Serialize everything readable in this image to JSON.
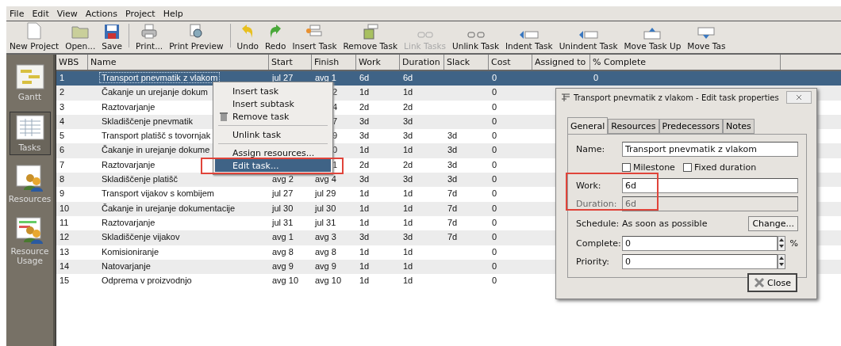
{
  "menu_bar": [
    "File",
    "Edit",
    "View",
    "Actions",
    "Project",
    "Help"
  ],
  "toolbar": [
    {
      "kind": "button",
      "label": "New Project",
      "disabled": false
    },
    {
      "kind": "button",
      "label": "Open...",
      "disabled": false
    },
    {
      "kind": "button",
      "label": "Save",
      "disabled": false
    },
    {
      "kind": "separator"
    },
    {
      "kind": "button",
      "label": "Print...",
      "disabled": false
    },
    {
      "kind": "button",
      "label": "Print Preview",
      "disabled": false
    },
    {
      "kind": "separator"
    },
    {
      "kind": "button",
      "label": "Undo",
      "disabled": false
    },
    {
      "kind": "button",
      "label": "Redo",
      "disabled": false
    },
    {
      "kind": "button",
      "label": "Insert Task",
      "disabled": false
    },
    {
      "kind": "button",
      "label": "Remove Task",
      "disabled": false
    },
    {
      "kind": "button",
      "label": "Link Tasks",
      "disabled": true
    },
    {
      "kind": "button",
      "label": "Unlink Task",
      "disabled": false
    },
    {
      "kind": "button",
      "label": "Indent Task",
      "disabled": false
    },
    {
      "kind": "button",
      "label": "Unindent Task",
      "disabled": false
    },
    {
      "kind": "button",
      "label": "Move Task Up",
      "disabled": false
    },
    {
      "kind": "button",
      "label": "Move Tas",
      "disabled": false
    }
  ],
  "sidebar": {
    "items": [
      {
        "label": "Gantt",
        "selected": false
      },
      {
        "label": "Tasks",
        "selected": true
      },
      {
        "label": "Resources",
        "selected": false
      },
      {
        "label": "Resource Usage",
        "selected": false
      }
    ]
  },
  "table": {
    "columns": [
      "WBS",
      "Name",
      "Start",
      "Finish",
      "Work",
      "Duration",
      "Slack",
      "Cost",
      "Assigned to",
      "% Complete"
    ],
    "rows": [
      {
        "selected": true,
        "cells": [
          "1",
          "Transport pnevmatik z vlakom",
          "jul 27",
          "avg 1",
          "6d",
          "6d",
          "",
          "0",
          "",
          "0"
        ]
      },
      {
        "selected": false,
        "cells": [
          "2",
          "Čakanje un urejanje dokum",
          "",
          "2",
          "1d",
          "1d",
          "",
          "0",
          "",
          ""
        ]
      },
      {
        "selected": false,
        "cells": [
          "3",
          "Raztovarjanje",
          "",
          "4",
          "2d",
          "2d",
          "",
          "0",
          "",
          ""
        ]
      },
      {
        "selected": false,
        "cells": [
          "4",
          "Skladiščenje pnevmatik",
          "",
          "7",
          "3d",
          "3d",
          "",
          "0",
          "",
          ""
        ]
      },
      {
        "selected": false,
        "cells": [
          "5",
          "Transport platišč s tovornjak",
          "",
          "9",
          "3d",
          "3d",
          "3d",
          "0",
          "",
          ""
        ]
      },
      {
        "selected": false,
        "cells": [
          "6",
          "Čakanje in urejanje dokume",
          "",
          "0",
          "1d",
          "1d",
          "3d",
          "0",
          "",
          ""
        ]
      },
      {
        "selected": false,
        "cells": [
          "7",
          "Raztovarjanje",
          "",
          "1",
          "2d",
          "2d",
          "3d",
          "0",
          "",
          ""
        ]
      },
      {
        "selected": false,
        "cells": [
          "8",
          "Skladiščenje platišč",
          "avg 2",
          "avg 4",
          "3d",
          "3d",
          "3d",
          "0",
          "",
          ""
        ]
      },
      {
        "selected": false,
        "cells": [
          "9",
          "Transport vijakov s kombijem",
          "jul 27",
          "jul 29",
          "1d",
          "1d",
          "7d",
          "0",
          "",
          ""
        ]
      },
      {
        "selected": false,
        "cells": [
          "10",
          "Čakanje in urejanje dokumentacije",
          "jul 30",
          "jul 30",
          "1d",
          "1d",
          "7d",
          "0",
          "",
          ""
        ]
      },
      {
        "selected": false,
        "cells": [
          "11",
          "Raztovarjanje",
          "jul 31",
          "jul 31",
          "1d",
          "1d",
          "7d",
          "0",
          "",
          ""
        ]
      },
      {
        "selected": false,
        "cells": [
          "12",
          "Skladiščenje vijakov",
          "avg 1",
          "avg 3",
          "3d",
          "3d",
          "7d",
          "0",
          "",
          ""
        ]
      },
      {
        "selected": false,
        "cells": [
          "13",
          "Komisioniranje",
          "avg 8",
          "avg 8",
          "1d",
          "1d",
          "",
          "0",
          "",
          ""
        ]
      },
      {
        "selected": false,
        "cells": [
          "14",
          "Natovarjanje",
          "avg 9",
          "avg 9",
          "1d",
          "1d",
          "",
          "0",
          "",
          ""
        ]
      },
      {
        "selected": false,
        "cells": [
          "15",
          "Odprema v proizvodnjo",
          "avg 10",
          "avg 10",
          "1d",
          "1d",
          "",
          "0",
          "",
          ""
        ]
      }
    ]
  },
  "context_menu": {
    "items": [
      {
        "kind": "item",
        "label": "Insert task",
        "selected": false
      },
      {
        "kind": "item",
        "label": "Insert subtask",
        "selected": false
      },
      {
        "kind": "icon_item",
        "label": "Remove task",
        "selected": false
      },
      {
        "kind": "separator"
      },
      {
        "kind": "item",
        "label": "Unlink task",
        "selected": false
      },
      {
        "kind": "separator"
      },
      {
        "kind": "item",
        "label": "Assign resources...",
        "selected": false
      },
      {
        "kind": "item",
        "label": "Edit task...",
        "selected": true
      }
    ]
  },
  "dialog": {
    "title": "Transport pnevmatik z vlakom - Edit task properties",
    "tabs": [
      {
        "label": "General",
        "selected": true
      },
      {
        "label": "Resources",
        "selected": false
      },
      {
        "label": "Predecessors",
        "selected": false
      },
      {
        "label": "Notes",
        "selected": false
      }
    ],
    "name": {
      "label": "Name:",
      "value": "Transport pnevmatik z vlakom"
    },
    "checkboxes": [
      {
        "label": "Milestone",
        "checked": false
      },
      {
        "label": "Fixed duration",
        "checked": false
      }
    ],
    "work": {
      "label": "Work:",
      "value": "6d",
      "disabled": false
    },
    "duration": {
      "label": "Duration:",
      "value": "6d",
      "disabled": true
    },
    "schedule": {
      "label": "Schedule:",
      "value": "As soon as possible",
      "button": "Change..."
    },
    "complete": {
      "label": "Complete:",
      "value": "0",
      "unit": "%"
    },
    "priority": {
      "label": "Priority:",
      "value": "0"
    },
    "close_button": "Close"
  }
}
